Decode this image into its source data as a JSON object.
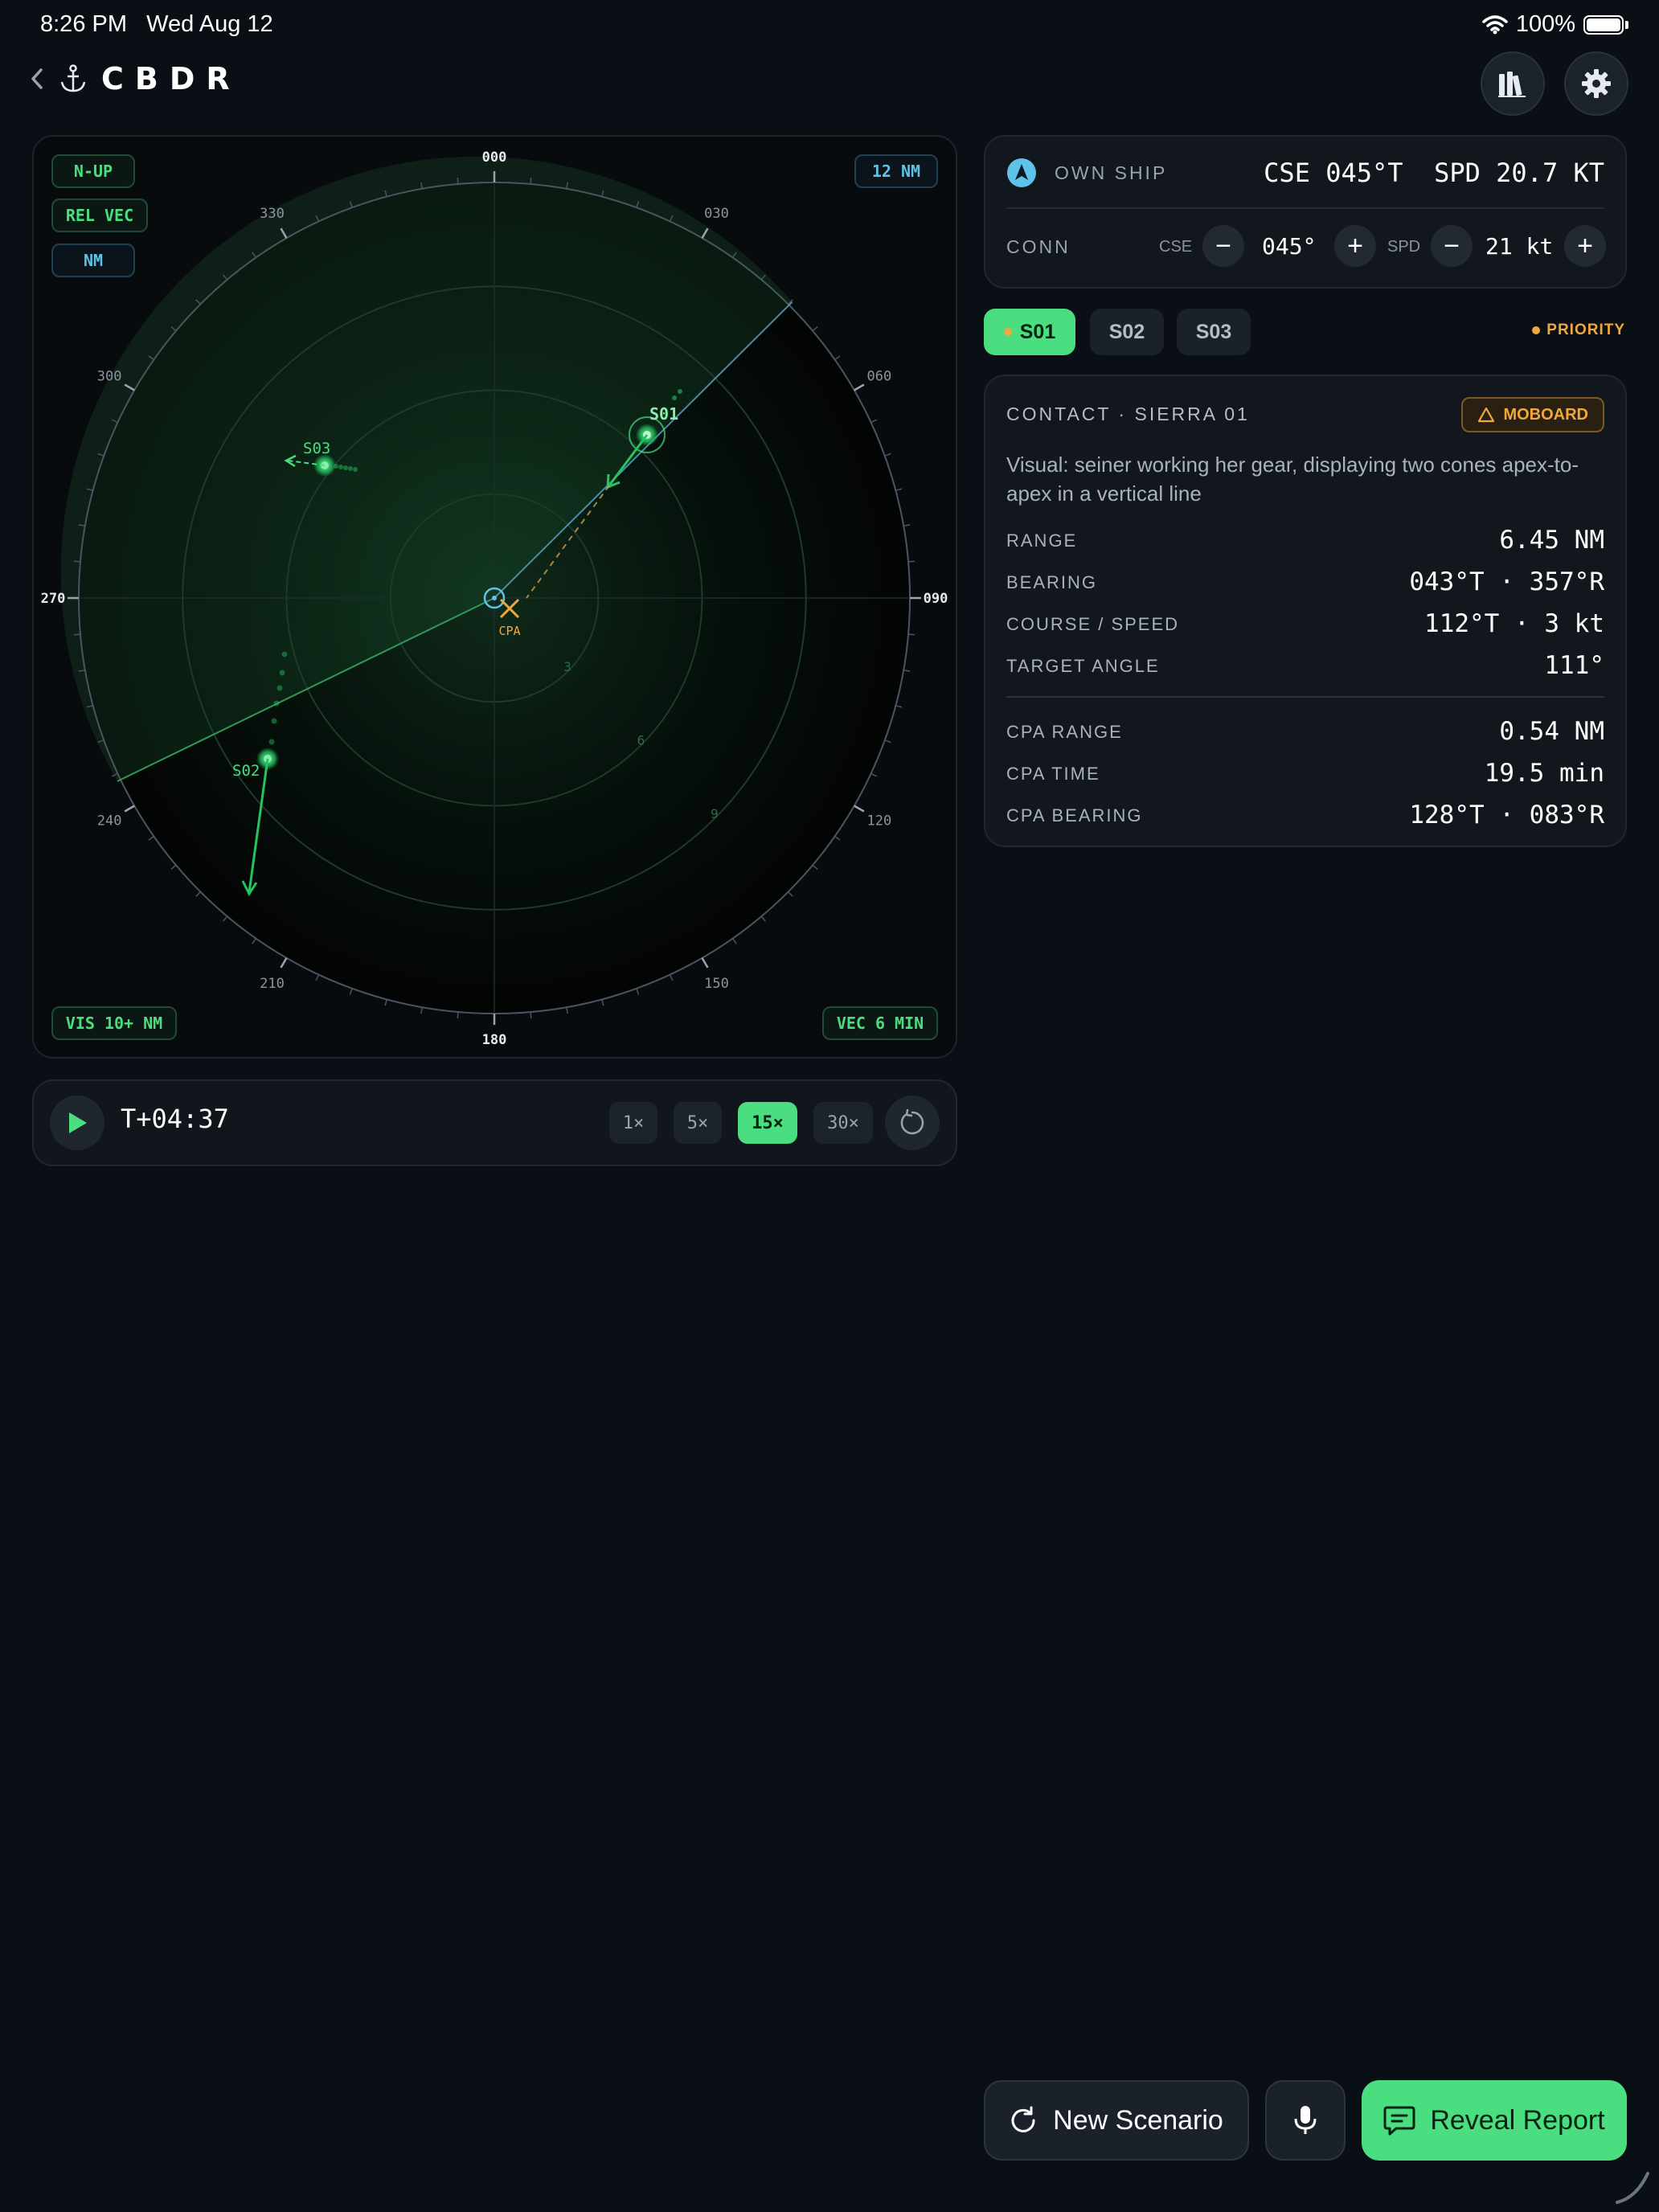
{
  "status_bar": {
    "time": "8:26 PM",
    "date": "Wed Aug 12",
    "battery": "100%",
    "icons": [
      "wifi-icon",
      "battery-icon"
    ]
  },
  "nav": {
    "title": "CBDR",
    "icons": [
      "chevron-left-icon",
      "anchor-icon",
      "library-icon",
      "gear-icon"
    ]
  },
  "radar": {
    "modes": {
      "orientation": "N-UP",
      "vector_mode": "REL VEC",
      "units": "NM"
    },
    "range_scale": "12 NM",
    "visibility": "VIS 10+ NM",
    "vector_time": "VEC 6 MIN",
    "bearing_labels": [
      "000",
      "030",
      "060",
      "090",
      "120",
      "150",
      "180",
      "210",
      "240",
      "270",
      "300",
      "330"
    ],
    "range_ring_labels": [
      "3",
      "6",
      "9"
    ],
    "cpa_label": "CPA",
    "contacts": [
      {
        "id": "S01",
        "bearing": 43,
        "range_nm": 6.45,
        "selected": true
      },
      {
        "id": "S02",
        "bearing": 236,
        "range_nm": 6.2
      },
      {
        "id": "S03",
        "bearing": 300,
        "range_nm": 5.5
      }
    ],
    "colors": {
      "contact": "#4ade80",
      "own_ship": "#5ec3e8",
      "cpa": "#f0a83c"
    }
  },
  "playback": {
    "timecode": "T+04:37",
    "speeds": [
      "1×",
      "5×",
      "15×",
      "30×"
    ],
    "active_speed": "15×"
  },
  "own_ship": {
    "label": "OWN SHIP",
    "readout": "CSE 045°T  SPD 20.7 KT",
    "conn_label": "CONN",
    "cse_label": "CSE",
    "cse_value": "045°",
    "spd_label": "SPD",
    "spd_value": "21 kt",
    "minus": "−",
    "plus": "+"
  },
  "tabs": [
    "S01",
    "S02",
    "S03"
  ],
  "active_tab": "S01",
  "priority_label": "PRIORITY",
  "contact": {
    "title": "CONTACT · SIERRA 01",
    "badge": "MOBOARD",
    "description": "Visual: seiner working her gear, displaying two cones apex-to-apex in a vertical line",
    "rows": [
      {
        "label": "RANGE",
        "value": "6.45 NM"
      },
      {
        "label": "BEARING",
        "value": "043°T · 357°R"
      },
      {
        "label": "COURSE / SPEED",
        "value": "112°T · 3 kt"
      },
      {
        "label": "TARGET ANGLE",
        "value": "111°"
      }
    ],
    "cpa_rows": [
      {
        "label": "CPA RANGE",
        "value": "0.54 NM"
      },
      {
        "label": "CPA TIME",
        "value": "19.5 min"
      },
      {
        "label": "CPA BEARING",
        "value": "128°T · 083°R"
      }
    ]
  },
  "actions": {
    "new_scenario": "New Scenario",
    "reveal_report": "Reveal Report"
  }
}
